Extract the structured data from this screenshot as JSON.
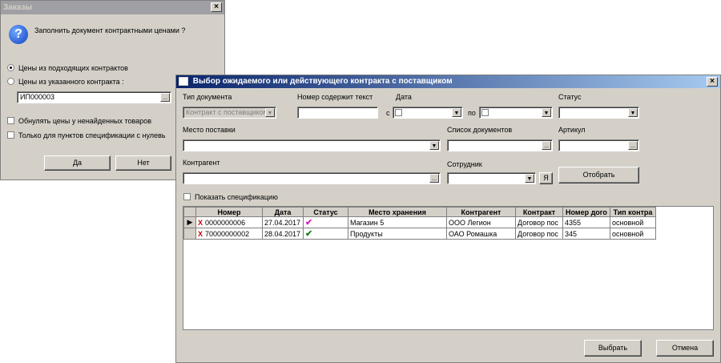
{
  "orders_dialog": {
    "title": "Заказы",
    "question": "Заполнить документ контрактными ценами ?",
    "radio_matching": "Цены из подходящих контрактов",
    "radio_specified": "Цены из указанного контракта :",
    "contract_value": "ИП000003",
    "ellipsis": "...",
    "check_zero_prices": "Обнулять цены у ненайденных товаров",
    "check_only_zero": "Только для пунктов спецификации с нулевь",
    "yes_label": "Да",
    "no_label": "Нет"
  },
  "contract_dialog": {
    "title": "Выбор ожидаемого или действующего контракта с поставщиком",
    "doc_type_label": "Тип документа",
    "doc_type_value": "Контракт с поставщиком",
    "number_contains_label": "Номер содержит текст",
    "date_label": "Дата",
    "from_label": "с",
    "to_label": "по",
    "status_label": "Статус",
    "delivery_place_label": "Место поставки",
    "doc_list_label": "Список документов",
    "article_label": "Артикул",
    "contractor_label": "Контрагент",
    "employee_label": "Сотрудник",
    "me_button": "Я",
    "filter_button": "Отобрать",
    "show_spec_label": "Показать спецификацию",
    "columns": [
      "",
      "Номер",
      "Дата",
      "Статус",
      "Место хранения",
      "Контрагент",
      "Контракт",
      "Номер дого",
      "Тип контра"
    ],
    "rows": [
      {
        "pointer": "▶",
        "number": "0000000006",
        "date": "27.04.2017",
        "status_icon": "check-magenta-icon",
        "storage": "Магазин 5",
        "contractor": "ООО Легион",
        "contract": "Договор пос",
        "contract_no": "4355",
        "contract_type": "основной"
      },
      {
        "pointer": "",
        "number": "70000000002",
        "date": "28.04.2017",
        "status_icon": "check-green-icon",
        "storage": "Продукты",
        "contractor": "ОАО Ромашка",
        "contract": "Договор пос",
        "contract_no": "345",
        "contract_type": "основной"
      }
    ],
    "select_button": "Выбрать",
    "cancel_button": "Отмена"
  },
  "colors": {
    "face": "#d4d0c8",
    "active_title": "#0a246a",
    "inactive_title": "#a0a0a4",
    "check_magenta": "#e020c0",
    "check_green": "#208020"
  }
}
